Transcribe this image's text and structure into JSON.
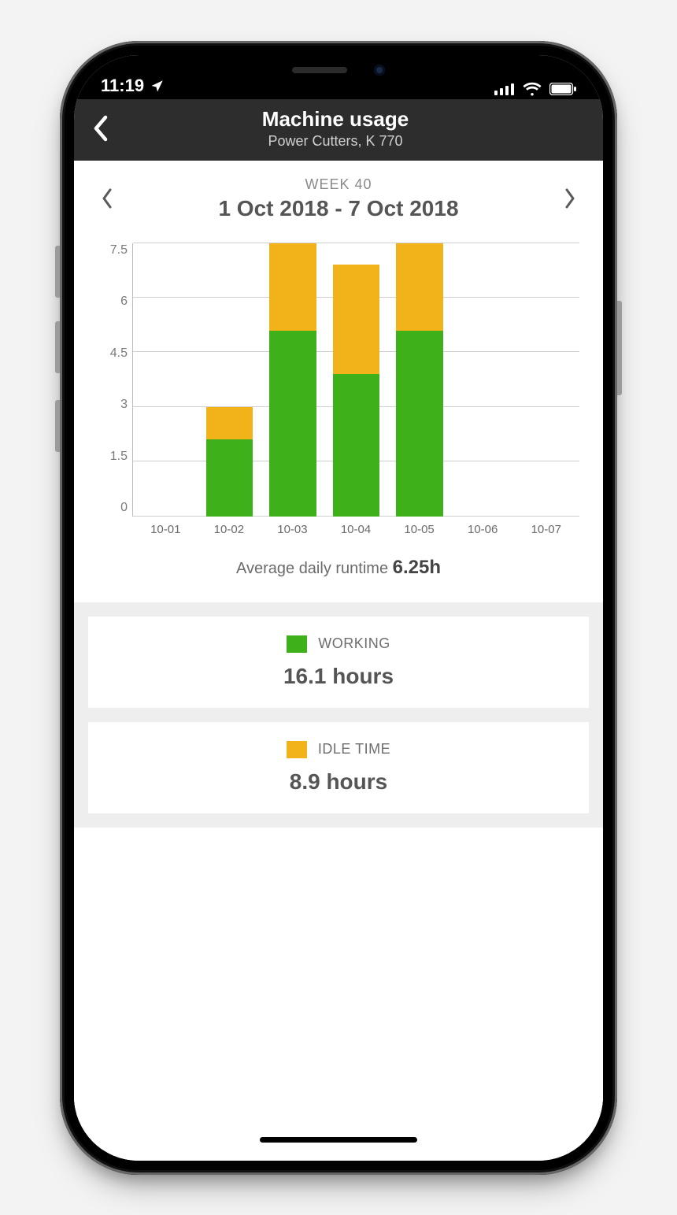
{
  "status": {
    "time": "11:19"
  },
  "header": {
    "title": "Machine usage",
    "subtitle": "Power Cutters, K 770"
  },
  "period": {
    "week_label": "WEEK 40",
    "range": "1 Oct 2018 - 7 Oct 2018"
  },
  "average": {
    "label": "Average daily runtime ",
    "value": "6.25h"
  },
  "legend": {
    "working": {
      "label": "WORKING",
      "value": "16.1 hours",
      "color": "#3eb01a"
    },
    "idle": {
      "label": "IDLE TIME",
      "value": "8.9 hours",
      "color": "#f2b31a"
    }
  },
  "chart_data": {
    "type": "bar",
    "categories": [
      "10-01",
      "10-02",
      "10-03",
      "10-04",
      "10-05",
      "10-06",
      "10-07"
    ],
    "series": [
      {
        "name": "WORKING",
        "values": [
          0,
          2.1,
          5.1,
          3.9,
          5.1,
          0,
          0
        ]
      },
      {
        "name": "IDLE TIME",
        "values": [
          0,
          0.9,
          2.4,
          3.0,
          2.4,
          0,
          0
        ]
      }
    ],
    "stacked": true,
    "ylabel": "",
    "xlabel": "",
    "title": "",
    "ylim": [
      0,
      7.5
    ],
    "y_ticks": [
      7.5,
      6.0,
      4.5,
      3.0,
      1.5,
      0
    ]
  }
}
